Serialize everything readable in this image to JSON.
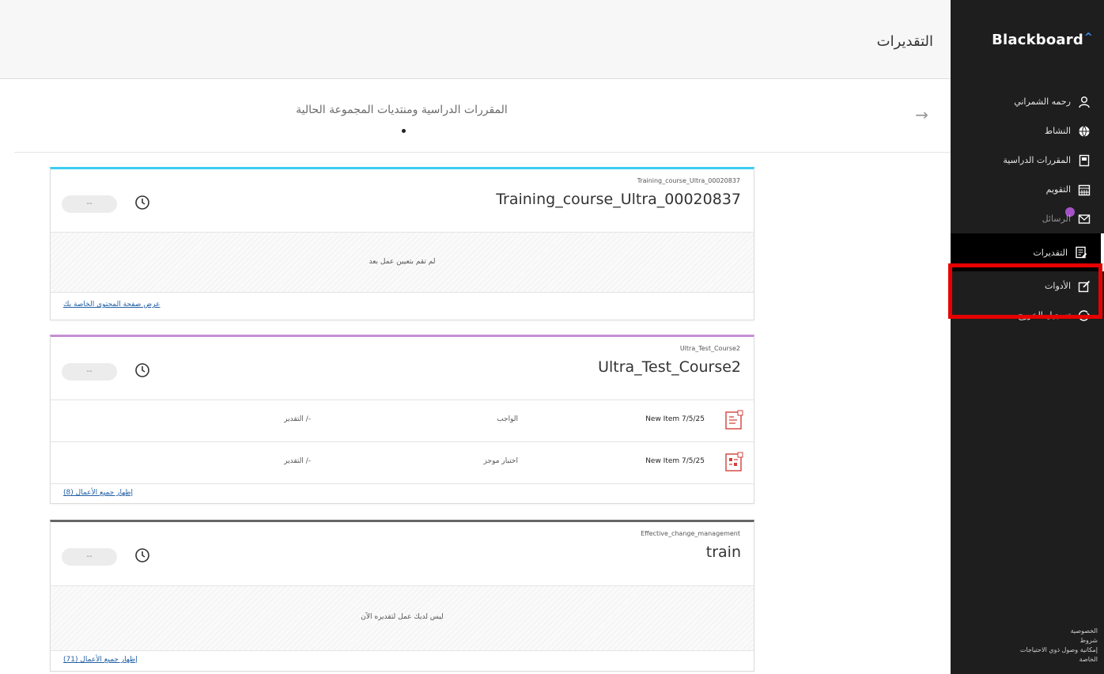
{
  "app": {
    "brand": "Blackboard",
    "page_title": "التقديرات"
  },
  "sidebar": {
    "items": [
      {
        "label": "رحمه الشمراني",
        "icon": "user-icon"
      },
      {
        "label": "النشاط",
        "icon": "globe-icon"
      },
      {
        "label": "المقررات الدراسية",
        "icon": "courses-icon"
      },
      {
        "label": "التقويم",
        "icon": "calendar-icon"
      },
      {
        "label": "الرسائل",
        "icon": "messages-icon"
      },
      {
        "label": "التقديرات",
        "icon": "grades-icon",
        "active": true
      },
      {
        "label": "الأدوات",
        "icon": "tools-icon"
      },
      {
        "label": "تسجيل الخروج",
        "icon": "logout-icon"
      }
    ],
    "footer": [
      "الخصوصية",
      "شروط",
      "إمكانية وصول ذوي الاحتياجات",
      "الخاصة"
    ]
  },
  "carousel": {
    "title": "المقررات الدراسية ومنتديات المجموعة الحالية"
  },
  "cards": [
    {
      "course_id": "Training_course_Ultra_00020837",
      "course_name": "Training_course_Ultra_00020837",
      "grade": "--",
      "accent": "#3dcdf2",
      "empty_text": "لم تقم بتعيين عمل بعد",
      "footer_link": "عرض صفحة المحتوى الخاصة بك"
    },
    {
      "course_id": "Ultra_Test_Course2",
      "course_name": "Ultra_Test_Course2",
      "grade": "--",
      "accent": "#c58fd3",
      "items": [
        {
          "name": "New Item 7/5/25",
          "type": "الواجب",
          "grade": "-/ التقدير",
          "icon": "assignment-icon"
        },
        {
          "name": "New Item 7/5/25",
          "type": "اختبار موجز",
          "grade": "-/ التقدير",
          "icon": "test-icon"
        }
      ],
      "footer_link": "إظهار جميع الأعمال (8)"
    },
    {
      "course_id": "Effective_change_management",
      "course_name": "train",
      "grade": "--",
      "accent": "#666666",
      "empty_text": "ليس لديك عمل لتقديره الآن",
      "footer_link": "إظهار جميع الأعمال (71)"
    }
  ],
  "colors": {
    "sidebar_bg": "#1e1e1e",
    "highlight": "#e60000",
    "link": "#2361a6"
  }
}
